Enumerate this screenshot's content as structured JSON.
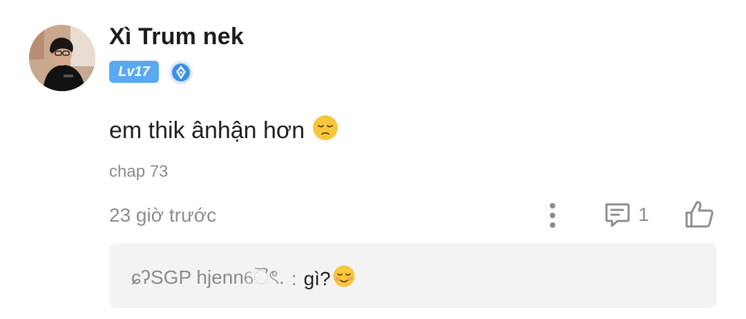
{
  "comment": {
    "author": {
      "name": "Xì Trum nek",
      "level": "Lv17",
      "avatar_icon": "avatar-photo",
      "rank_icon": "rank-pen-icon"
    },
    "text": "em thik ânhận hơn",
    "text_emoji": "pensive-face-emoji",
    "chapter": "chap 73",
    "time": "23 giờ trước",
    "actions": {
      "more_icon": "more-vertical-icon",
      "reply_icon": "comment-icon",
      "reply_count": "1",
      "like_icon": "thumbs-up-icon"
    }
  },
  "reply": {
    "author": "ɕʔSGP hjennୈৎ.",
    "separator": ":",
    "text": "gì?",
    "text_emoji": "relieved-face-emoji"
  },
  "colors": {
    "level_badge": "#5aa8f0",
    "rank_icon": "#3b8ee8",
    "muted_text": "#8c8c8c",
    "reply_bg": "#f3f3f3"
  }
}
